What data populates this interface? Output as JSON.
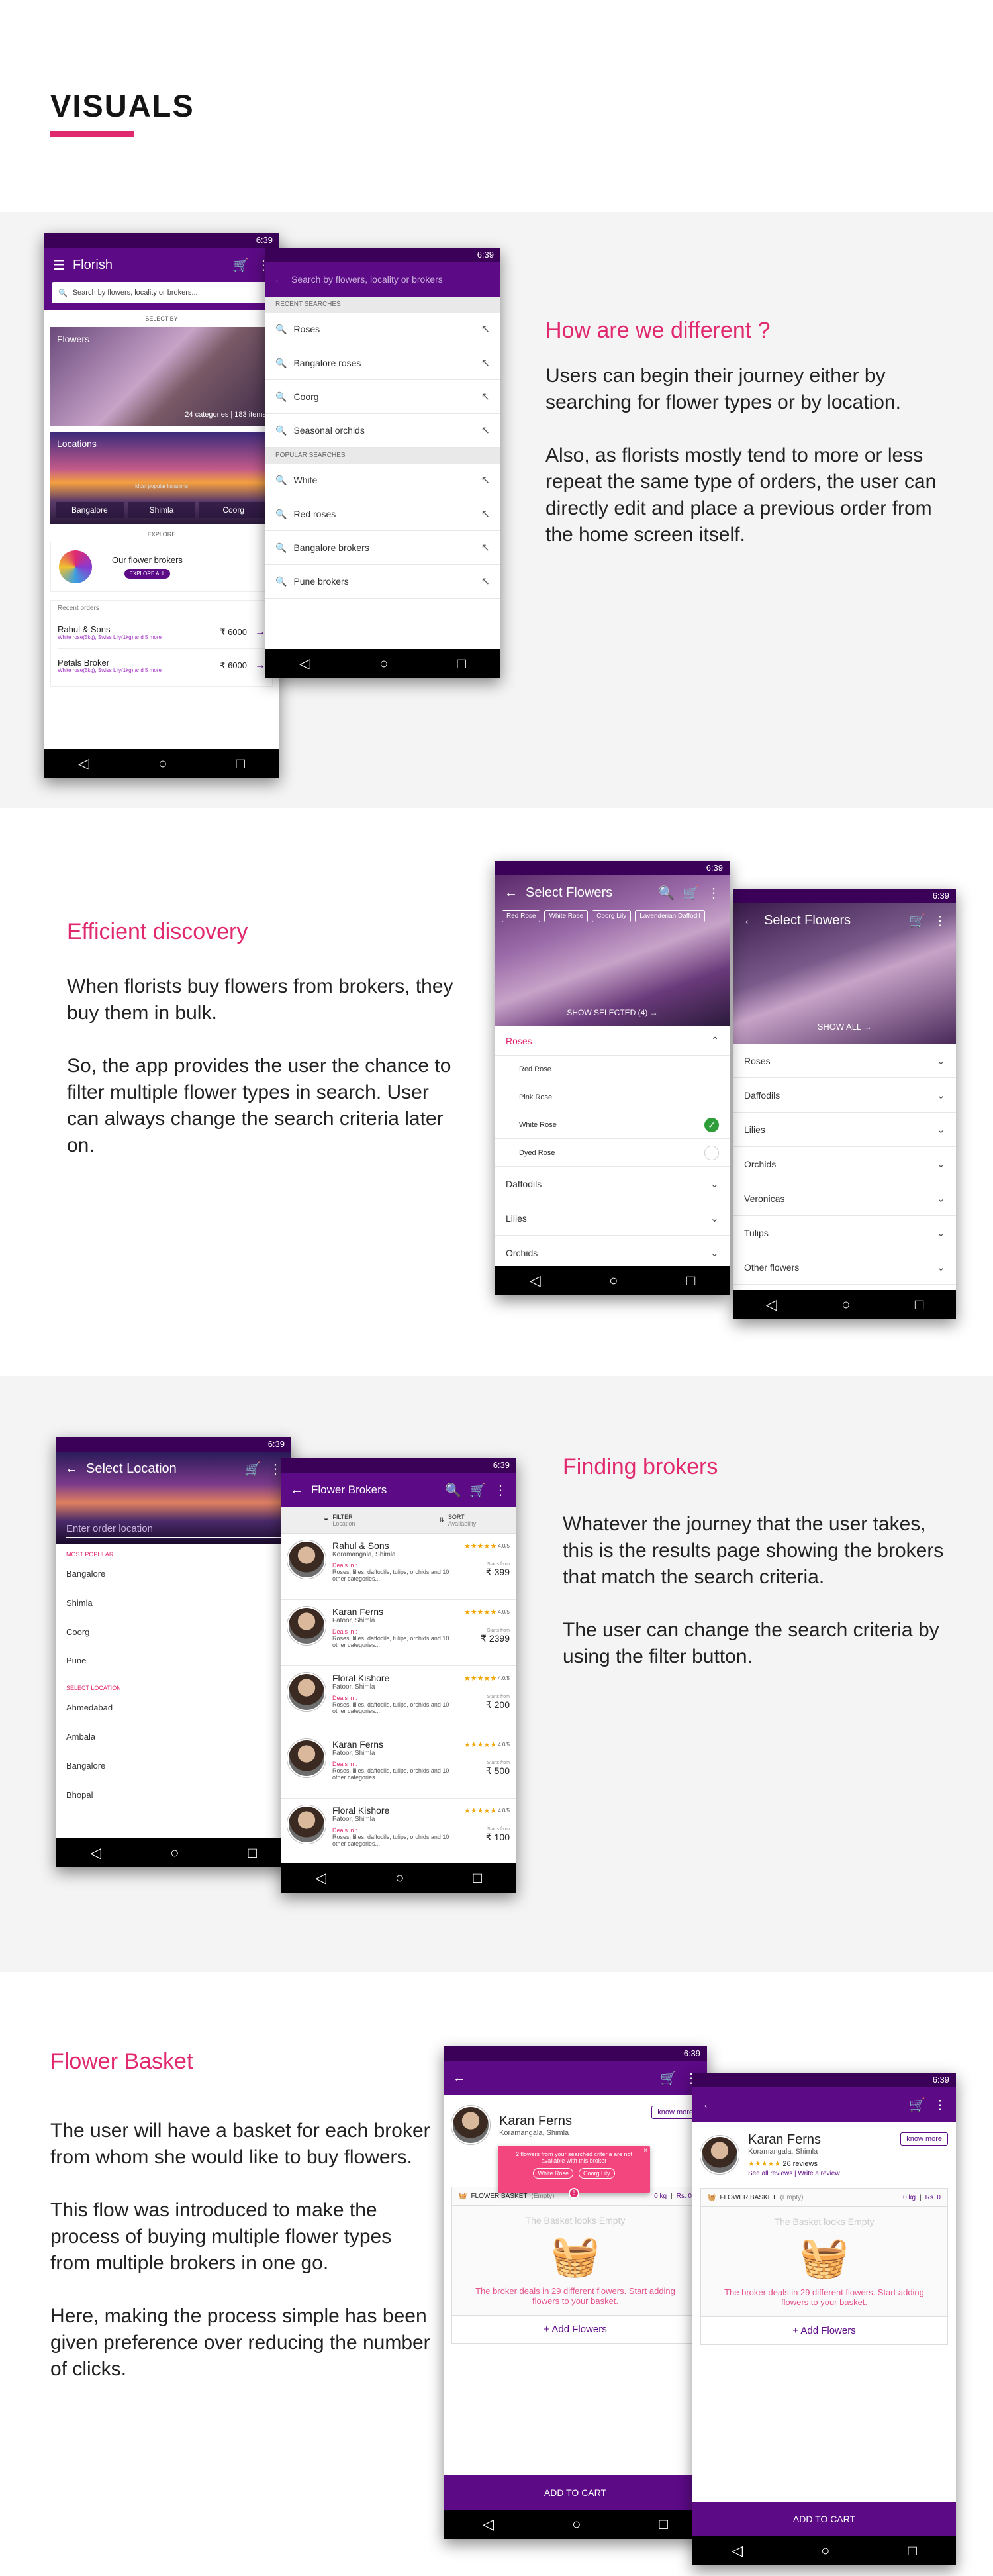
{
  "visuals": {
    "title": "VISUALS"
  },
  "sec1": {
    "heading": "How are we different ?",
    "p1": "Users can begin their journey either by searching for flower types or by location.",
    "p2": "Also, as florists mostly tend to more or less repeat the same type of orders, the user can directly edit and place a previous order from the home screen itself."
  },
  "sec2": {
    "heading": "Efficient discovery",
    "p1": "When florists buy flowers from brokers, they buy them in bulk.",
    "p2": "So, the app provides the user the chance to filter multiple flower types in search. User can always change the search criteria later on."
  },
  "sec3": {
    "heading": "Finding brokers",
    "p1": "Whatever the journey that the user takes, this is the results page showing the brokers that match the search criteria.",
    "p2": "The user can change the search criteria by using the filter button."
  },
  "sec4": {
    "heading": "Flower Basket",
    "p1": "The user will have a basket for each broker from whom she would like to buy flowers.",
    "p2": "This flow was introduced to make the process of buying multiple flower types from multiple brokers in one go.",
    "p3": "Here, making the process simple has been given preference over reducing the number of clicks."
  },
  "status": {
    "time": "6:39"
  },
  "home": {
    "title": "Florish",
    "search_placeholder": "Search by flowers, locality or brokers...",
    "select_by": "SELECT BY",
    "flowers_label": "Flowers",
    "flowers_count": "24 categories | 183 items",
    "locations_label": "Locations",
    "most_popular": "Most popular locations",
    "loc1": "Bangalore",
    "loc2": "Shimla",
    "loc3": "Coorg",
    "explore": "EXPLORE",
    "brokers_text": "Our flower brokers",
    "explore_all": "EXPLORE ALL",
    "recent_orders": "Recent orders",
    "order1_name": "Rahul & Sons",
    "order1_items": "White rose(5kg), Swiss Lily(1kg) and 5 more",
    "order1_price": "₹ 6000",
    "order2_name": "Petals Broker",
    "order2_items": "White rose(5kg), Swiss Lily(1kg) and 5 more",
    "order2_price": "₹ 6000"
  },
  "search": {
    "placeholder": "Search by flowers, locality or brokers",
    "recent_head": "RECENT SEARCHES",
    "recent": [
      "Roses",
      "Bangalore roses",
      "Coorg",
      "Seasonal orchids"
    ],
    "popular_head": "POPULAR SEARCHES",
    "popular": [
      "White",
      "Red roses",
      "Bangalore brokers",
      "Pune brokers"
    ]
  },
  "select_flowers": {
    "title": "Select Flowers",
    "chips": [
      "Red Rose",
      "White Rose",
      "Coorg Lily",
      "Lavenderian Daffodil"
    ],
    "show_selected": "SHOW SELECTED (4)",
    "show_all": "SHOW ALL",
    "group": "Roses",
    "sub": [
      "Red Rose",
      "Pink Rose",
      "White Rose",
      "Dyed Rose"
    ],
    "groups": [
      "Daffodils",
      "Lilies",
      "Orchids"
    ],
    "groups2": [
      "Roses",
      "Daffodils",
      "Lilies",
      "Orchids",
      "Veronicas",
      "Tulips",
      "Other flowers"
    ]
  },
  "select_location": {
    "title": "Select Location",
    "placeholder": "Enter order location",
    "most_popular": "MOST POPULAR",
    "popular": [
      "Bangalore",
      "Shimla",
      "Coorg",
      "Pune"
    ],
    "select_head": "SELECT LOCATION",
    "all": [
      "Ahmedabad",
      "Ambala",
      "Bangalore",
      "Bhopal"
    ]
  },
  "brokers": {
    "title": "Flower Brokers",
    "filter": "FILTER",
    "filter_sub": "Location",
    "sort": "SORT",
    "sort_sub": "Availability",
    "deals_in": "Deals in :",
    "deals_text": "Roses, lilies, daffodils, tulips, orchids and 10 other categories...",
    "starts_from": "Starts from",
    "list": [
      {
        "name": "Rahul & Sons",
        "loc": "Koramangala, Shimla",
        "rating": "4.0/5",
        "price": "₹ 399"
      },
      {
        "name": "Karan Ferns",
        "loc": "Fatoor, Shimla",
        "rating": "4.0/5",
        "price": "₹ 2399"
      },
      {
        "name": "Floral Kishore",
        "loc": "Fatoor, Shimla",
        "rating": "4.0/5",
        "price": "₹ 200"
      },
      {
        "name": "Karan Ferns",
        "loc": "Fatoor, Shimla",
        "rating": "4.0/5",
        "price": "₹ 500"
      },
      {
        "name": "Floral Kishore",
        "loc": "Fatoor, Shimla",
        "rating": "4.0/5",
        "price": "₹ 100"
      }
    ]
  },
  "basket": {
    "name": "Karan Ferns",
    "loc": "Koramangala, Shimla",
    "know_more": "know more",
    "reviews": "26 reviews",
    "see_all": "See all reviews | Write a review",
    "popup": "2 flowers from your searched criteria are not available with this broker",
    "pop_chip1": "White Rose",
    "pop_chip2": "Coorg Lily",
    "basket_label": "FLOWER BASKET",
    "empty": "(Empty)",
    "weight": "0 kg",
    "rs": "Rs. 0",
    "empty_title": "The Basket looks Empty",
    "empty_msg": "The broker deals in 29 different flowers. Start adding flowers to your basket.",
    "add_flowers": "+ Add Flowers",
    "add_to_cart": "ADD TO CART"
  }
}
